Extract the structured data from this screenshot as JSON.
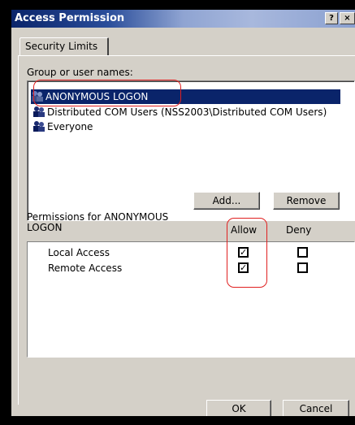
{
  "window": {
    "title": "Access Permission",
    "help_button": "?",
    "close_button": "×"
  },
  "tab": {
    "label": "Security Limits"
  },
  "group_section": {
    "label": "Group or user names:",
    "users": [
      {
        "name": "ANONYMOUS LOGON",
        "selected": true
      },
      {
        "name": "Distributed COM Users (NSS2003\\Distributed COM Users)",
        "selected": false
      },
      {
        "name": "Everyone",
        "selected": false
      }
    ]
  },
  "buttons": {
    "add": "Add...",
    "remove": "Remove",
    "ok": "OK",
    "cancel": "Cancel"
  },
  "permissions": {
    "label_line1": "Permissions for ANONYMOUS",
    "label_line2": "LOGON",
    "allow_header": "Allow",
    "deny_header": "Deny",
    "rows": [
      {
        "name": "Local Access",
        "allow": true,
        "deny": false
      },
      {
        "name": "Remote Access",
        "allow": true,
        "deny": false
      }
    ]
  },
  "colors": {
    "title_bar": "#0a246a",
    "selection": "#0a246a",
    "dialog_face": "#d4d0c8",
    "annotation": "#e02020"
  }
}
